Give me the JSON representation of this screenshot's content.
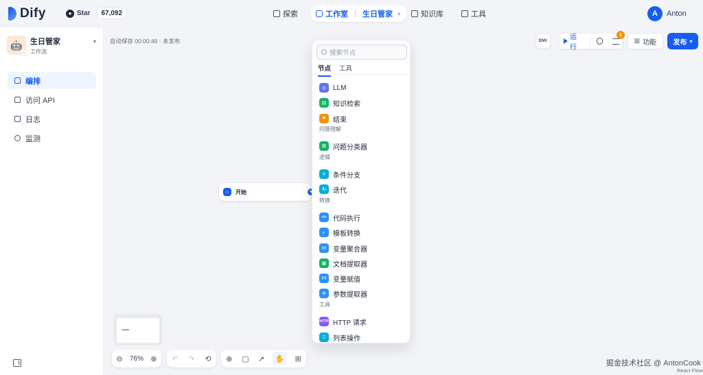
{
  "brand": {
    "name": "Dify"
  },
  "github": {
    "label": "Star",
    "count": "67,092"
  },
  "nav": {
    "explore": "探索",
    "studio": "工作室",
    "current_app": "生日管家",
    "knowledge": "知识库",
    "tools": "工具"
  },
  "user": {
    "initial": "A",
    "name": "Anton"
  },
  "app": {
    "name": "生日管家",
    "type": "工作流"
  },
  "sidebar": {
    "items": [
      {
        "label": "编排",
        "icon": "orchestrate-icon"
      },
      {
        "label": "访问 API",
        "icon": "terminal-icon"
      },
      {
        "label": "日志",
        "icon": "log-icon"
      },
      {
        "label": "监测",
        "icon": "monitor-icon"
      }
    ]
  },
  "canvas": {
    "autosave": "自动保存 00:00:46 · 未发布",
    "env_label": "ENV",
    "run_label": "运行",
    "notify_count": "1",
    "features_label": "功能",
    "publish_label": "发布",
    "start_node_label": "开始",
    "zoom": "76%"
  },
  "node_picker": {
    "search_placeholder": "搜索节点",
    "tabs": [
      "节点",
      "工具"
    ],
    "items": [
      {
        "label": "LLM",
        "color": "#6172f3",
        "glyph": "◎"
      },
      {
        "label": "知识检索",
        "color": "#16b364",
        "glyph": "▤"
      },
      {
        "label": "结束",
        "color": "#f79009",
        "glyph": "⚑"
      },
      {
        "group": "问题理解"
      },
      {
        "label": "问题分类器",
        "color": "#16b364",
        "glyph": "⊞"
      },
      {
        "group": "逻辑"
      },
      {
        "label": "条件分支",
        "color": "#06aed4",
        "glyph": "⑂"
      },
      {
        "label": "迭代",
        "color": "#06aed4",
        "glyph": "↻"
      },
      {
        "group": "转换"
      },
      {
        "label": "代码执行",
        "color": "#2e90fa",
        "glyph": "</>"
      },
      {
        "label": "模板转换",
        "color": "#2e90fa",
        "glyph": "◐"
      },
      {
        "label": "变量聚合器",
        "color": "#2e90fa",
        "glyph": "[x]"
      },
      {
        "label": "文档提取器",
        "color": "#16b364",
        "glyph": "▣"
      },
      {
        "label": "变量赋值",
        "color": "#2e90fa",
        "glyph": "{=}"
      },
      {
        "label": "参数提取器",
        "color": "#2e90fa",
        "glyph": "✲"
      },
      {
        "group": "工具"
      },
      {
        "label": "HTTP 请求",
        "color": "#875bf7",
        "glyph": "HTTP"
      },
      {
        "label": "列表操作",
        "color": "#06aed4",
        "glyph": "▽"
      }
    ]
  },
  "footer": {
    "watermark": "掘金技术社区 @ AntonCook",
    "reactflow": "React Flow"
  }
}
